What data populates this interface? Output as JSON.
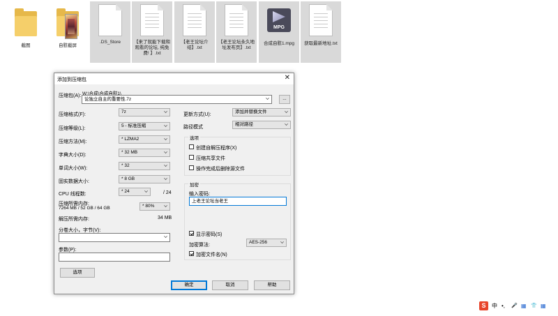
{
  "desktop": {
    "files": [
      {
        "label": "截图"
      },
      {
        "label": "自慰截屏"
      },
      {
        "label": ".DS_Store"
      },
      {
        "label": "【来了就能下载和观看的论坛, 纯免费! 】.txt"
      },
      {
        "label": "【老王论坛介绍】.txt"
      },
      {
        "label": "【老王论坛永久地址发布页】.txt"
      },
      {
        "label": "合成自慰1.mpg",
        "badge": "MPG"
      },
      {
        "label": "获取最新地址.txt"
      }
    ]
  },
  "dialog": {
    "title": "添加到压缩包",
    "close_glyph": "✕",
    "archive": {
      "label": "压缩包(A):",
      "path": "W:\\合成\\合成自慰1\\",
      "filename": "论独立自主的重要性.7z",
      "browse_label": "..."
    },
    "left": {
      "format_label": "压缩格式(F):",
      "format_value": "7z",
      "level_label": "压缩等级(L):",
      "level_value": "5 - 标准压缩",
      "method_label": "压缩方法(M):",
      "method_value": "* LZMA2",
      "dict_label": "字典大小(D):",
      "dict_value": "* 32 MB",
      "word_label": "单词大小(W):",
      "word_value": "* 32",
      "solid_label": "固实数据大小:",
      "solid_value": "* 8 GB",
      "threads_label": "CPU 线程数:",
      "threads_value": "* 24",
      "threads_total": "/ 24",
      "mem_comp_label": "压缩所需内存:",
      "mem_comp_value": "7264 MB / 52 GB / 64 GB",
      "mem_percent": "* 80%",
      "mem_decomp_label": "解压所需内存:",
      "mem_decomp_value": "34 MB",
      "split_label": "分卷大小，字节(V):",
      "split_value": "",
      "params_label": "参数(P):",
      "params_value": "",
      "options_button": "选项"
    },
    "right": {
      "update_label": "更新方式(U):",
      "update_value": "添加并替换文件",
      "path_label": "路径模式",
      "path_value": "相对路径",
      "options_group": "选项",
      "opt_sfx": "创建自解压程序(X)",
      "opt_shared": "压缩共享文件",
      "opt_delete": "操作完成后删除源文件",
      "encrypt_group": "加密",
      "password_label": "输入密码:",
      "password_value": "上老王论坛当老王",
      "show_password": "显示密码(S)",
      "encrypt_method_label": "加密算法:",
      "encrypt_method_value": "AES-256",
      "encrypt_names": "加密文件名(N)"
    },
    "buttons": {
      "ok": "确定",
      "cancel": "取消",
      "help": "帮助"
    }
  },
  "ime": {
    "sogou": "S",
    "mode": "中",
    "punct": "•,",
    "mic": "🎤",
    "keyboard": "▦",
    "skin": "👕",
    "tools": "▦"
  }
}
